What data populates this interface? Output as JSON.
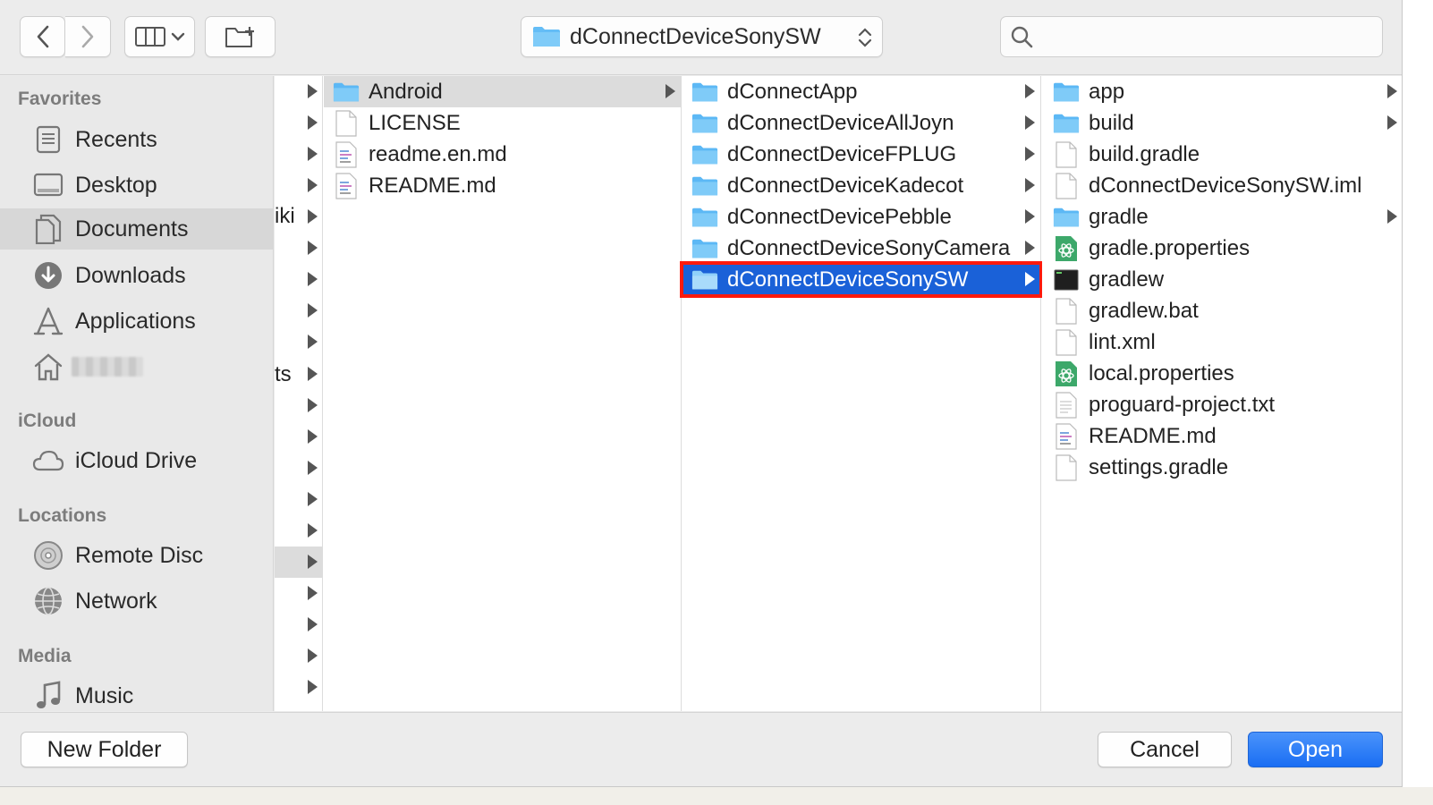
{
  "toolbar": {
    "path_label": "dConnectDeviceSonySW",
    "search_placeholder": ""
  },
  "sidebar": {
    "sections": [
      {
        "label": "Favorites",
        "items": [
          {
            "label": "Recents",
            "icon": "recents-icon"
          },
          {
            "label": "Desktop",
            "icon": "desktop-icon"
          },
          {
            "label": "Documents",
            "icon": "documents-icon",
            "selected": true
          },
          {
            "label": "Downloads",
            "icon": "downloads-icon"
          },
          {
            "label": "Applications",
            "icon": "applications-icon"
          },
          {
            "label": "",
            "icon": "home-icon",
            "redacted": true
          }
        ]
      },
      {
        "label": "iCloud",
        "items": [
          {
            "label": "iCloud Drive",
            "icon": "cloud-icon"
          }
        ]
      },
      {
        "label": "Locations",
        "items": [
          {
            "label": "Remote Disc",
            "icon": "disc-icon"
          },
          {
            "label": "Network",
            "icon": "network-icon"
          }
        ]
      },
      {
        "label": "Media",
        "items": [
          {
            "label": "Music",
            "icon": "music-icon"
          }
        ]
      }
    ]
  },
  "columns": {
    "col0_fragments": [
      "iki",
      "ts"
    ],
    "col1": [
      {
        "name": "Android",
        "type": "folder",
        "has_children": true,
        "highlighted": true
      },
      {
        "name": "LICENSE",
        "type": "file"
      },
      {
        "name": "readme.en.md",
        "type": "text"
      },
      {
        "name": "README.md",
        "type": "text"
      }
    ],
    "col2": [
      {
        "name": "dConnectApp",
        "type": "folder",
        "has_children": true
      },
      {
        "name": "dConnectDeviceAllJoyn",
        "type": "folder",
        "has_children": true
      },
      {
        "name": "dConnectDeviceFPLUG",
        "type": "folder",
        "has_children": true
      },
      {
        "name": "dConnectDeviceKadecot",
        "type": "folder",
        "has_children": true
      },
      {
        "name": "dConnectDevicePebble",
        "type": "folder",
        "has_children": true
      },
      {
        "name": "dConnectDeviceSonyCamera",
        "type": "folder",
        "has_children": true
      },
      {
        "name": "dConnectDeviceSonySW",
        "type": "folder",
        "has_children": true,
        "selected": true
      }
    ],
    "col3": [
      {
        "name": "app",
        "type": "folder",
        "has_children": true
      },
      {
        "name": "build",
        "type": "folder",
        "has_children": true
      },
      {
        "name": "build.gradle",
        "type": "file"
      },
      {
        "name": "dConnectDeviceSonySW.iml",
        "type": "file"
      },
      {
        "name": "gradle",
        "type": "folder",
        "has_children": true
      },
      {
        "name": "gradle.properties",
        "type": "atom"
      },
      {
        "name": "gradlew",
        "type": "exec"
      },
      {
        "name": "gradlew.bat",
        "type": "file"
      },
      {
        "name": "lint.xml",
        "type": "file"
      },
      {
        "name": "local.properties",
        "type": "atom"
      },
      {
        "name": "proguard-project.txt",
        "type": "doc"
      },
      {
        "name": "README.md",
        "type": "text"
      },
      {
        "name": "settings.gradle",
        "type": "file"
      }
    ]
  },
  "footer": {
    "new_folder_label": "New Folder",
    "cancel_label": "Cancel",
    "open_label": "Open"
  },
  "colors": {
    "selection": "#1a61d8",
    "selection_outline": "#ff1a0d",
    "folder": "#5cb8f5",
    "primary_button": "#1a6ef3"
  }
}
